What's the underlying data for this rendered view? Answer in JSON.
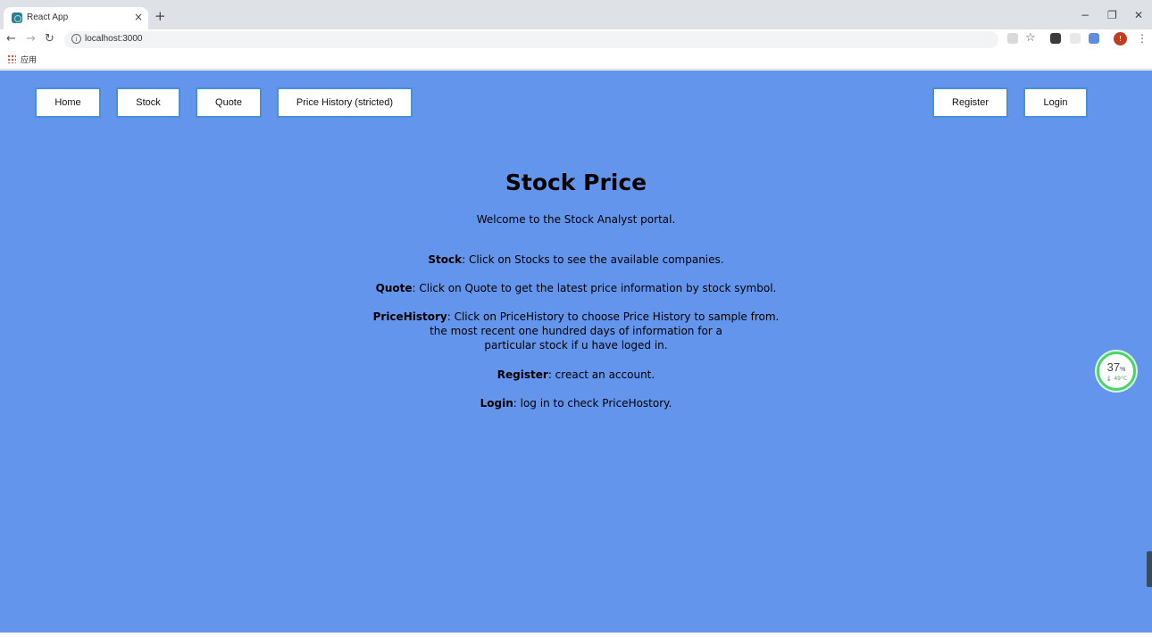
{
  "browser": {
    "tab_title": "React App",
    "tab_close": "×",
    "new_tab": "+",
    "url": "localhost:3000",
    "bookmarks_apps_label": "应用",
    "profile_initial": "!",
    "window_controls": {
      "minimize": "−",
      "restore": "❐",
      "close": "✕"
    }
  },
  "nav": {
    "left": [
      {
        "label": "Home"
      },
      {
        "label": "Stock"
      },
      {
        "label": "Quote"
      },
      {
        "label": "Price History (stricted)"
      }
    ],
    "right": [
      {
        "label": "Register"
      },
      {
        "label": "Login"
      }
    ]
  },
  "main": {
    "title": "Stock Price",
    "welcome": "Welcome to the Stock Analyst portal.",
    "items": [
      {
        "term": "Stock",
        "text": ": Click on Stocks to see the available companies."
      },
      {
        "term": "Quote",
        "text": ": Click on Quote to get the latest price information by stock symbol."
      },
      {
        "term": "PriceHistory",
        "text": ": Click on PriceHistory to choose Price History to sample from.",
        "continuation": [
          "the most recent one hundred days of information for a",
          "particular stock if u have loged in."
        ]
      },
      {
        "term": "Register",
        "text": ": creact an account."
      },
      {
        "term": "Login",
        "text": ": log in to check PriceHostory."
      }
    ]
  },
  "widget": {
    "value": "37",
    "unit": "%",
    "temp": "🌡 49°C"
  },
  "colors": {
    "page_bg": "#6495ed",
    "button_border": "#4a90d9",
    "widget_ring": "#4cd36b"
  }
}
